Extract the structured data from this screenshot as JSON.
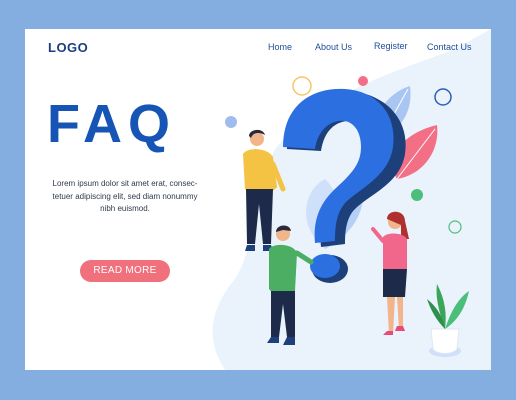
{
  "header": {
    "logo": "LOGO",
    "nav": [
      "Home",
      "About Us",
      "Register",
      "Contact Us"
    ]
  },
  "hero": {
    "title": "FAQ",
    "description": "Lorem ipsum dolor sit amet erat, consec-tetuer adipiscing elit, sed diam nonummy nibh euismod.",
    "cta_label": "READ MORE"
  },
  "colors": {
    "page_background": "#84aedf",
    "title_blue": "#1655b5",
    "button_pink": "#f0707c",
    "question_mark_blue": "#2c6fe0"
  },
  "illustration": {
    "icons": [
      "question-mark-icon",
      "leaf-icon",
      "plant-pot-icon",
      "circle-decor-icon"
    ]
  }
}
